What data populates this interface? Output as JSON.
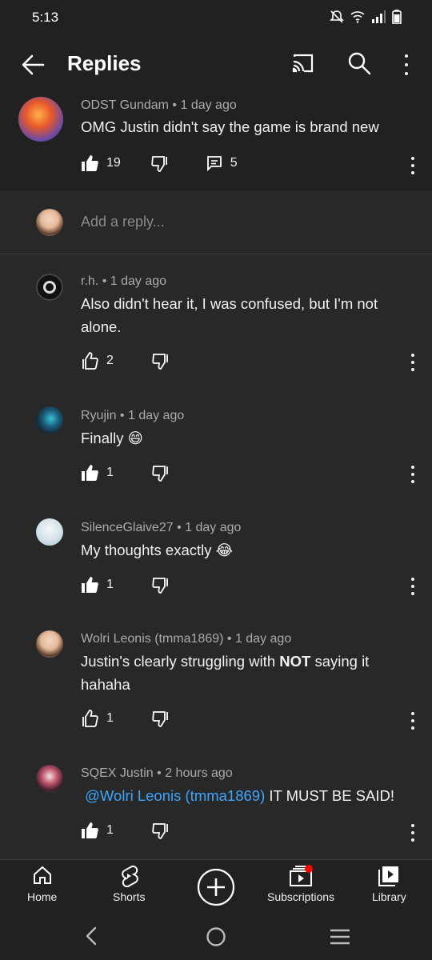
{
  "status": {
    "time": "5:13"
  },
  "app_bar": {
    "title": "Replies"
  },
  "parent": {
    "author": "ODST Gundam",
    "time": "1 day ago",
    "text": "OMG Justin didn't say the game is brand new",
    "likes": "19",
    "replies": "5"
  },
  "reply_box": {
    "placeholder": "Add a reply..."
  },
  "comments": [
    {
      "author": "r.h.",
      "time": "1 day ago",
      "text": "Also didn't hear it, I was confused, but I'm not alone.",
      "likes": "2"
    },
    {
      "author": "Ryujin",
      "time": "1 day ago",
      "text": "Finally 😄",
      "likes": "1"
    },
    {
      "author": "SilenceGlaive27",
      "time": "1 day ago",
      "text": "My thoughts exactly 😂",
      "likes": "1"
    },
    {
      "author": "Wolri Leonis (tmma1869)",
      "time": "1 day ago",
      "text_before": "Justin's clearly struggling with ",
      "text_bold": "NOT",
      "text_after": " saying it hahaha",
      "likes": "1"
    },
    {
      "author": "SQEX Justin",
      "time": "2 hours ago",
      "mention": "@Wolri Leonis (tmma1869)",
      "text": " IT MUST BE SAID!",
      "likes": "1"
    }
  ],
  "bottom_nav": {
    "home": "Home",
    "shorts": "Shorts",
    "subscriptions": "Subscriptions",
    "library": "Library"
  },
  "colors": {
    "background": "#282828",
    "surface": "#212121",
    "mention": "#3ea6ff",
    "notification_dot": "#ff0000"
  }
}
